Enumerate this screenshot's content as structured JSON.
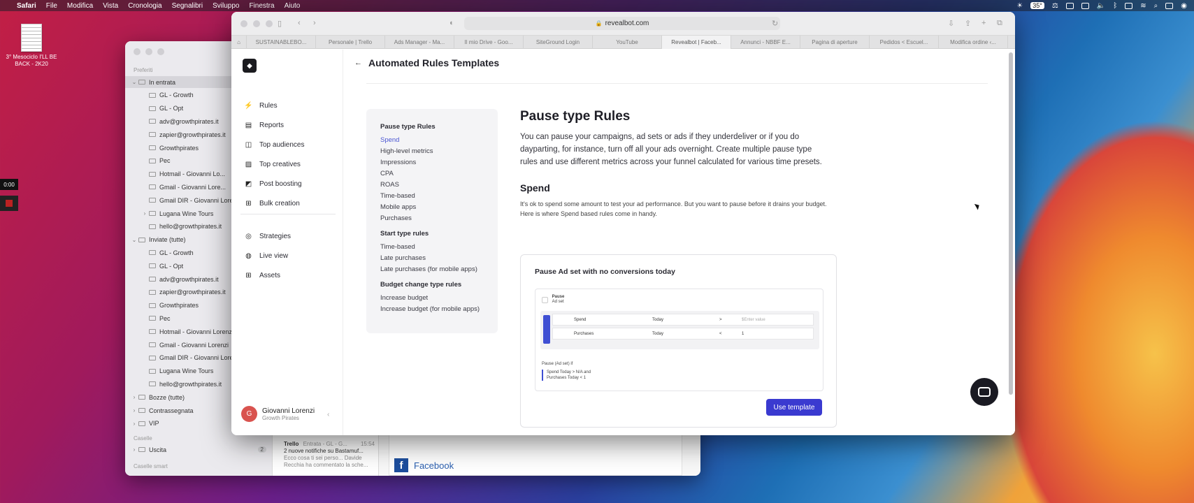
{
  "menubar": {
    "apple": "",
    "app": "Safari",
    "items": [
      "File",
      "Modifica",
      "Vista",
      "Cronologia",
      "Segnalibri",
      "Sviluppo",
      "Finestra",
      "Aiuto"
    ],
    "temperature": "35°"
  },
  "desktop": {
    "file_label": "3° Mesociclo I'LL BE BACK - 2K20",
    "timer": "0:00"
  },
  "mail": {
    "section_favorites": "Preferiti",
    "section_mailboxes": "Caselle",
    "section_smart": "Caselle smart",
    "inbox": "In entrata",
    "inbox_items": [
      "GL - Growth",
      "GL - Opt",
      "adv@growthpirates.it",
      "zapier@growthpirates.it",
      "Growthpirates",
      "Pec",
      "Hotmail - Giovanni Lo...",
      "Gmail - Giovanni Lore...",
      "Gmail DIR - Giovanni Lore...",
      "Lugana Wine Tours",
      "hello@growthpirates.it"
    ],
    "sent": "Inviate (tutte)",
    "sent_items": [
      "GL - Growth",
      "GL - Opt",
      "adv@growthpirates.it",
      "zapier@growthpirates.it",
      "Growthpirates",
      "Pec",
      "Hotmail - Giovanni Lorenzi",
      "Gmail - Giovanni Lorenzi",
      "Gmail DIR - Giovanni Lorenzi",
      "Lugana Wine Tours",
      "hello@growthpirates.it"
    ],
    "drafts": "Bozze (tutte)",
    "flagged": "Contrassegnata",
    "vip": "VIP",
    "outbox": "Uscita",
    "outbox_count": "2",
    "message": {
      "sender": "Trello",
      "meta": "Entrata - GL - G...",
      "time": "15:54",
      "subject": "2 nuove notifiche su Bastamuf...",
      "preview": "Ecco cosa ti sei perso... Davide Recchia ha commentato la sche..."
    },
    "facebook_label": "Facebook"
  },
  "safari": {
    "url": "revealbot.com",
    "tabs": [
      "SUSTAINABLEBO...",
      "Personale | Trello",
      "Ads Manager - Ma...",
      "Il mio Drive - Goo...",
      "SiteGround Login",
      "YouTube",
      "Revealbot | Faceb...",
      "Annunci - NBBF E...",
      "Pagina di aperture",
      "Pedidos < Escuel...",
      "Modifica ordine ‹..."
    ],
    "active_tab": 6
  },
  "app": {
    "nav": [
      {
        "label": "Rules",
        "icon": "bolt-icon"
      },
      {
        "label": "Reports",
        "icon": "chart-icon"
      },
      {
        "label": "Top audiences",
        "icon": "audience-icon"
      },
      {
        "label": "Top creatives",
        "icon": "image-icon"
      },
      {
        "label": "Post boosting",
        "icon": "boost-icon"
      },
      {
        "label": "Bulk creation",
        "icon": "plus-square-icon"
      }
    ],
    "nav2": [
      {
        "label": "Strategies",
        "icon": "strategy-icon"
      },
      {
        "label": "Live view",
        "icon": "globe-icon"
      },
      {
        "label": "Assets",
        "icon": "grid-icon"
      }
    ],
    "user": {
      "initial": "G",
      "name": "Giovanni Lorenzi",
      "org": "Growth Pirates"
    },
    "page_title": "Automated Rules Templates",
    "toc": {
      "pause_heading": "Pause type Rules",
      "pause_items": [
        "Spend",
        "High-level metrics",
        "Impressions",
        "CPA",
        "ROAS",
        "Time-based",
        "Mobile apps",
        "Purchases"
      ],
      "start_heading": "Start type rules",
      "start_items": [
        "Time-based",
        "Late purchases",
        "Late purchases (for mobile apps)"
      ],
      "budget_heading": "Budget change type rules",
      "budget_items": [
        "Increase budget",
        "Increase budget (for mobile apps)"
      ]
    },
    "content": {
      "title": "Pause type Rules",
      "lead": "You can pause your campaigns, ad sets or ads if they underdeliver or if you do dayparting, for instance, turn off all your ads overnight. Create multiple pause type rules and use different metrics across your funnel calculated for various time presets.",
      "spend_title": "Spend",
      "spend_text": "It's ok to spend some amount to test your ad performance. But you want to pause before it drains your budget. Here is where Spend based rules come in handy."
    },
    "card": {
      "title": "Pause Ad set with no conversions today",
      "preview": {
        "action": "Pause",
        "target": "Ad set",
        "and_label": "AND",
        "rows": [
          {
            "metric": "Spend",
            "period": "Today",
            "op": ">",
            "value": "$Enter value"
          },
          {
            "metric": "Purchases",
            "period": "Today",
            "op": "<",
            "value": "1"
          }
        ],
        "summary_title": "Pause (Ad set) if",
        "summary_1": "Spend Today > N/A and",
        "summary_2": "Purchases Today < 1"
      },
      "button": "Use template"
    }
  },
  "colors": {
    "accent": "#3a3ad0",
    "link": "#4b56d2"
  }
}
